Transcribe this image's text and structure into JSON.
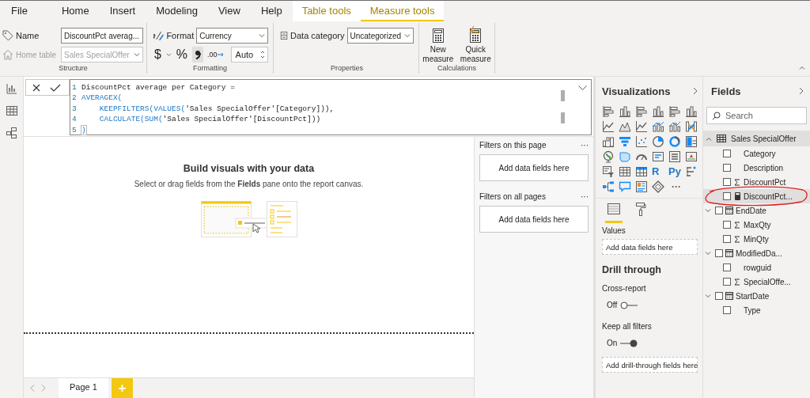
{
  "ribbon_tabs": [
    {
      "label": "File",
      "kind": "file",
      "selected": false
    },
    {
      "label": "Home",
      "kind": "main",
      "selected": false
    },
    {
      "label": "Insert",
      "kind": "main",
      "selected": false
    },
    {
      "label": "Modeling",
      "kind": "main",
      "selected": false
    },
    {
      "label": "View",
      "kind": "main",
      "selected": false
    },
    {
      "label": "Help",
      "kind": "main",
      "selected": false
    },
    {
      "label": "Table tools",
      "kind": "contextual",
      "selected": false
    },
    {
      "label": "Measure tools",
      "kind": "contextual",
      "selected": true
    }
  ],
  "structure": {
    "name_label": "Name",
    "name_value": "DiscountPct averag...",
    "home_table_label": "Home table",
    "home_table_value": "Sales SpecialOffer",
    "home_table_disabled": true,
    "group_label": "Structure"
  },
  "formatting": {
    "format_label": "Format",
    "format_value": "Currency",
    "currency_text": "$",
    "percent_text": "%",
    "comma_pressed": true,
    "decimal_text": ".00",
    "decimals_value": "Auto",
    "group_label": "Formatting"
  },
  "properties": {
    "data_category_label": "Data category",
    "data_category_value": "Uncategorized",
    "group_label": "Properties"
  },
  "calculations": {
    "buttons": [
      {
        "kind": "new",
        "label": "New measure"
      },
      {
        "kind": "quick",
        "label": "Quick measure"
      }
    ],
    "group_label": "Calculations"
  },
  "left_nav": [
    {
      "kind": "report"
    },
    {
      "kind": "data"
    },
    {
      "kind": "model"
    }
  ],
  "formula_bar": {
    "lines": [
      {
        "number": "1",
        "segments": [
          {
            "kind": "text",
            "text": "DiscountPct average per Category ="
          }
        ]
      },
      {
        "number": "2",
        "segments": [
          {
            "kind": "function",
            "text": "AVERAGEX("
          }
        ]
      },
      {
        "number": "3",
        "segments": [
          {
            "kind": "function",
            "text": "    KEEPFILTERS(VALUES("
          },
          {
            "kind": "text",
            "text": "'Sales SpecialOffer'[Category])),"
          }
        ]
      },
      {
        "number": "4",
        "segments": [
          {
            "kind": "function",
            "text": "    CALCULATE(SUM("
          },
          {
            "kind": "text",
            "text": "'Sales SpecialOffer'[DiscountPct]))"
          }
        ]
      },
      {
        "number": "5",
        "segments": [
          {
            "kind": "bracket",
            "text": ")"
          }
        ]
      }
    ]
  },
  "canvas": {
    "title": "Build visuals with your data",
    "hint": "Select or drag fields from the **Fields** pane onto the report canvas."
  },
  "pages": [
    {
      "label": "Page 1",
      "selected": true
    }
  ],
  "add_page": "+",
  "filters": {
    "sections": [
      {
        "title": "Filters on this page",
        "more": "···",
        "drop": "Add data fields here"
      },
      {
        "title": "Filters on all pages",
        "more": "···",
        "drop": "Add data fields here"
      }
    ]
  },
  "visualizations": {
    "title": "Visualizations",
    "items": [
      {
        "kind": "hbar"
      },
      {
        "kind": "column"
      },
      {
        "kind": "hbar"
      },
      {
        "kind": "column"
      },
      {
        "kind": "hbar"
      },
      {
        "kind": "column"
      },
      {
        "kind": "line"
      },
      {
        "kind": "area"
      },
      {
        "kind": "line"
      },
      {
        "kind": "combo"
      },
      {
        "kind": "combo"
      },
      {
        "kind": "ribbon"
      },
      {
        "kind": "waterfall"
      },
      {
        "kind": "funnel"
      },
      {
        "kind": "scatter"
      },
      {
        "kind": "pie"
      },
      {
        "kind": "donut"
      },
      {
        "kind": "treemap"
      },
      {
        "kind": "globe"
      },
      {
        "kind": "map"
      },
      {
        "kind": "gauge"
      },
      {
        "kind": "card"
      },
      {
        "kind": "multicard"
      },
      {
        "kind": "kpi"
      },
      {
        "kind": "slicer"
      },
      {
        "kind": "table"
      },
      {
        "kind": "matrix"
      },
      {
        "kind": "glyph",
        "text": "R"
      },
      {
        "kind": "glyph",
        "text": "Py"
      },
      {
        "kind": "influencers"
      },
      {
        "kind": "tree"
      },
      {
        "kind": "speech"
      },
      {
        "kind": "narrative"
      },
      {
        "kind": "diamond"
      },
      {
        "kind": "more",
        "text": "···"
      }
    ],
    "tabs": [
      {
        "kind": "fields",
        "selected": true
      },
      {
        "kind": "format",
        "selected": false
      }
    ],
    "values_label": "Values",
    "values_drop": "Add data fields here",
    "drill_title": "Drill through",
    "toggles": [
      {
        "label": "Cross-report",
        "state_label": "Off",
        "on": false
      },
      {
        "label": "Keep all filters",
        "state_label": "On",
        "on": true
      }
    ],
    "drill_drop": "Add drill-through fields here"
  },
  "fields": {
    "title": "Fields",
    "search_placeholder": "Search",
    "tables": [
      {
        "name": "Sales SpecialOffer",
        "expanded": true,
        "children": [
          {
            "name": "Category",
            "kind": "text",
            "checked": false,
            "selected": false
          },
          {
            "name": "Description",
            "kind": "text",
            "checked": false,
            "selected": false
          },
          {
            "name": "DiscountPct",
            "kind": "sum",
            "checked": false,
            "selected": false
          },
          {
            "name": "DiscountPct...",
            "kind": "measure",
            "checked": false,
            "selected": true
          },
          {
            "name": "EndDate",
            "kind": "date",
            "checked": false,
            "selected": false,
            "expanded": false
          },
          {
            "name": "MaxQty",
            "kind": "sum",
            "checked": false,
            "selected": false
          },
          {
            "name": "MinQty",
            "kind": "sum",
            "checked": false,
            "selected": false
          },
          {
            "name": "ModifiedDa...",
            "kind": "date",
            "checked": false,
            "selected": false,
            "expanded": false
          },
          {
            "name": "rowguid",
            "kind": "text",
            "checked": false,
            "selected": false
          },
          {
            "name": "SpecialOffe...",
            "kind": "sum",
            "checked": false,
            "selected": false
          },
          {
            "name": "StartDate",
            "kind": "date",
            "checked": false,
            "selected": false,
            "expanded": false
          },
          {
            "name": "Type",
            "kind": "text",
            "checked": false,
            "selected": false
          }
        ]
      }
    ]
  }
}
